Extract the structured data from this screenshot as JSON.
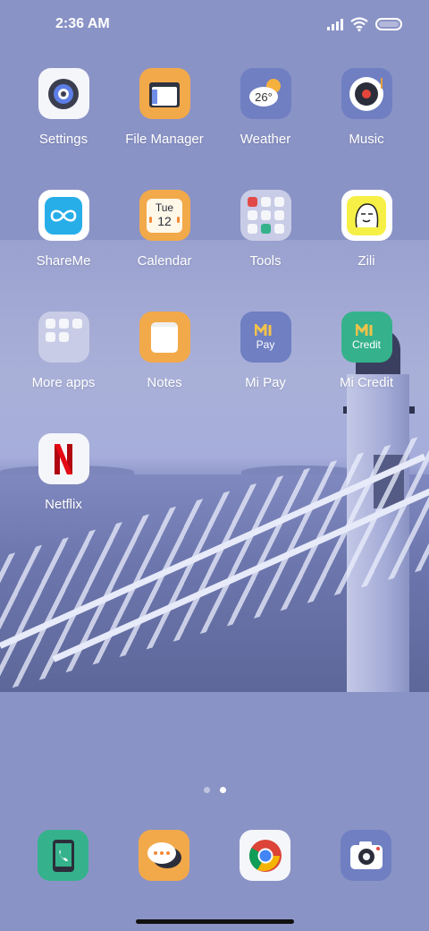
{
  "status_bar": {
    "time": "2:36 AM"
  },
  "apps": [
    {
      "label": "Settings"
    },
    {
      "label": "File Manager"
    },
    {
      "label": "Weather",
      "icon_text": "26°"
    },
    {
      "label": "Music"
    },
    {
      "label": "ShareMe"
    },
    {
      "label": "Calendar",
      "icon_day": "Tue",
      "icon_date": "12"
    },
    {
      "label": "Tools"
    },
    {
      "label": "Zili"
    },
    {
      "label": "More apps"
    },
    {
      "label": "Notes"
    },
    {
      "label": "Mi Pay",
      "icon_text": "Pay"
    },
    {
      "label": "Mi Credit",
      "icon_text": "Credit"
    },
    {
      "label": "Netflix"
    }
  ],
  "pager": {
    "pages": 2,
    "current": 2
  },
  "dock": [
    {
      "name": "phone"
    },
    {
      "name": "messaging"
    },
    {
      "name": "chrome"
    },
    {
      "name": "camera"
    }
  ],
  "colors": {
    "background": "#8a93c6",
    "orange": "#f2a94a",
    "blue_tile": "#6f7fc2",
    "green_tile": "#35b28b"
  }
}
